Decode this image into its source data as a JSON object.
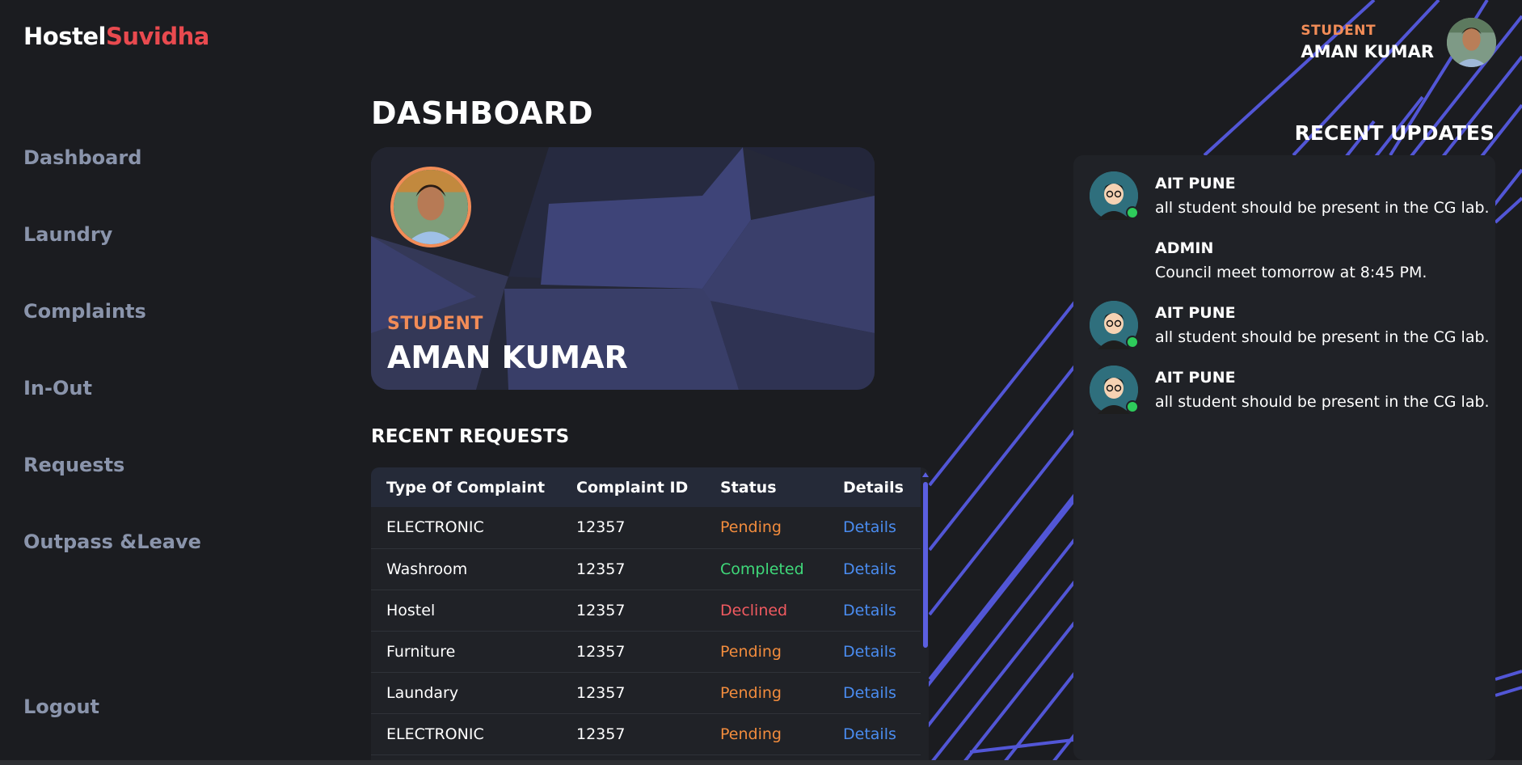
{
  "app": {
    "logo_part1": "Hostel",
    "logo_part2": "Suvidha"
  },
  "sidebar": {
    "items": [
      {
        "label": "Dashboard"
      },
      {
        "label": "Laundry"
      },
      {
        "label": "Complaints"
      },
      {
        "label": "In-Out"
      },
      {
        "label": "Requests"
      },
      {
        "label": "Outpass &Leave"
      }
    ],
    "logout_label": "Logout"
  },
  "user": {
    "role": "STUDENT",
    "name": "AMAN KUMAR"
  },
  "main": {
    "title": "DASHBOARD",
    "profile_card": {
      "role": "STUDENT",
      "name": "AMAN KUMAR"
    },
    "recent_requests": {
      "title": "RECENT REQUESTS",
      "headers": [
        "Type Of Complaint",
        "Complaint ID",
        "Status",
        "Details"
      ],
      "rows": [
        {
          "type": "ELECTRONIC",
          "id": "12357",
          "status": "Pending",
          "details": "Details"
        },
        {
          "type": "Washroom",
          "id": "12357",
          "status": "Completed",
          "details": "Details"
        },
        {
          "type": "Hostel",
          "id": "12357",
          "status": "Declined",
          "details": "Details"
        },
        {
          "type": "Furniture",
          "id": "12357",
          "status": "Pending",
          "details": "Details"
        },
        {
          "type": "Laundary",
          "id": "12357",
          "status": "Pending",
          "details": "Details"
        },
        {
          "type": "ELECTRONIC",
          "id": "12357",
          "status": "Pending",
          "details": "Details"
        }
      ]
    }
  },
  "updates": {
    "title": "RECENT UPDATES",
    "items": [
      {
        "title": "AIT PUNE",
        "text": "all student should be present in the CG lab.",
        "has_avatar": true
      },
      {
        "title": "ADMIN",
        "text": "Council meet tomorrow at 8:45 PM.",
        "has_avatar": false
      },
      {
        "title": "AIT PUNE",
        "text": "all student should be present in the CG lab.",
        "has_avatar": true
      },
      {
        "title": "AIT PUNE",
        "text": "all student should be present in the CG lab.",
        "has_avatar": true
      }
    ]
  },
  "colors": {
    "background": "#1b1c20",
    "accent_orange": "#f28c57",
    "logo_red": "#e94a4f",
    "pending": "#f28c3d",
    "completed": "#3fd97a",
    "declined": "#f05a60",
    "link": "#4a8cf0",
    "stripe": "#5b5fe0"
  }
}
